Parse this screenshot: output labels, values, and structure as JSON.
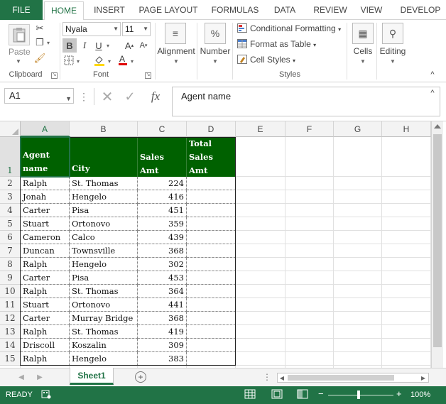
{
  "ribbon_tabs": [
    "FILE",
    "HOME",
    "INSERT",
    "PAGE LAYOUT",
    "FORMULAS",
    "DATA",
    "REVIEW",
    "VIEW",
    "DEVELOP"
  ],
  "active_tab": "HOME",
  "clipboard": {
    "paste_label": "Paste",
    "group_label": "Clipboard"
  },
  "font": {
    "name": "Nyala",
    "size": "11",
    "bold": "B",
    "italic": "I",
    "underline": "U",
    "grow": "A",
    "shrink": "A",
    "group_label": "Font"
  },
  "alignment": {
    "label": "Alignment"
  },
  "number": {
    "label": "Number",
    "symbol": "%"
  },
  "styles": {
    "conditional": "Conditional Formatting",
    "format_table": "Format as Table",
    "cell_styles": "Cell Styles",
    "group_label": "Styles"
  },
  "cells": {
    "label": "Cells"
  },
  "editing": {
    "label": "Editing"
  },
  "formula_bar": {
    "name_box": "A1",
    "formula": "Agent name",
    "fx": "fx"
  },
  "columns": [
    "A",
    "B",
    "C",
    "D",
    "E",
    "F",
    "G",
    "H"
  ],
  "rows": [
    "1",
    "2",
    "3",
    "4",
    "5",
    "6",
    "7",
    "8",
    "9",
    "10",
    "11",
    "12",
    "13",
    "14",
    "15"
  ],
  "table_headers": [
    [
      "Agent",
      "name"
    ],
    [
      "",
      "City"
    ],
    [
      "",
      "Sales Amt"
    ],
    [
      "Total",
      "Sales Amt"
    ]
  ],
  "table_rows": [
    [
      "Ralph",
      "St. Thomas",
      "224",
      ""
    ],
    [
      "Jonah",
      "Hengelo",
      "416",
      ""
    ],
    [
      "Carter",
      "Pisa",
      "451",
      ""
    ],
    [
      "Stuart",
      "Ortonovo",
      "359",
      ""
    ],
    [
      "Cameron",
      "Calco",
      "439",
      ""
    ],
    [
      "Duncan",
      "Townsville",
      "368",
      ""
    ],
    [
      "Ralph",
      "Hengelo",
      "302",
      ""
    ],
    [
      "Carter",
      "Pisa",
      "453",
      ""
    ],
    [
      "Ralph",
      "St. Thomas",
      "364",
      ""
    ],
    [
      "Stuart",
      "Ortonovo",
      "441",
      ""
    ],
    [
      "Carter",
      "Murray Bridge",
      "368",
      ""
    ],
    [
      "Ralph",
      "St. Thomas",
      "419",
      ""
    ],
    [
      "Driscoll",
      "Koszalin",
      "309",
      ""
    ],
    [
      "Ralph",
      "Hengelo",
      "383",
      ""
    ]
  ],
  "sheet_tabs": [
    "Sheet1"
  ],
  "status": {
    "mode": "READY",
    "zoom": "100%"
  },
  "colors": {
    "excel_green": "#217346",
    "header_fill": "#006100",
    "header_text": "#ffffff"
  }
}
